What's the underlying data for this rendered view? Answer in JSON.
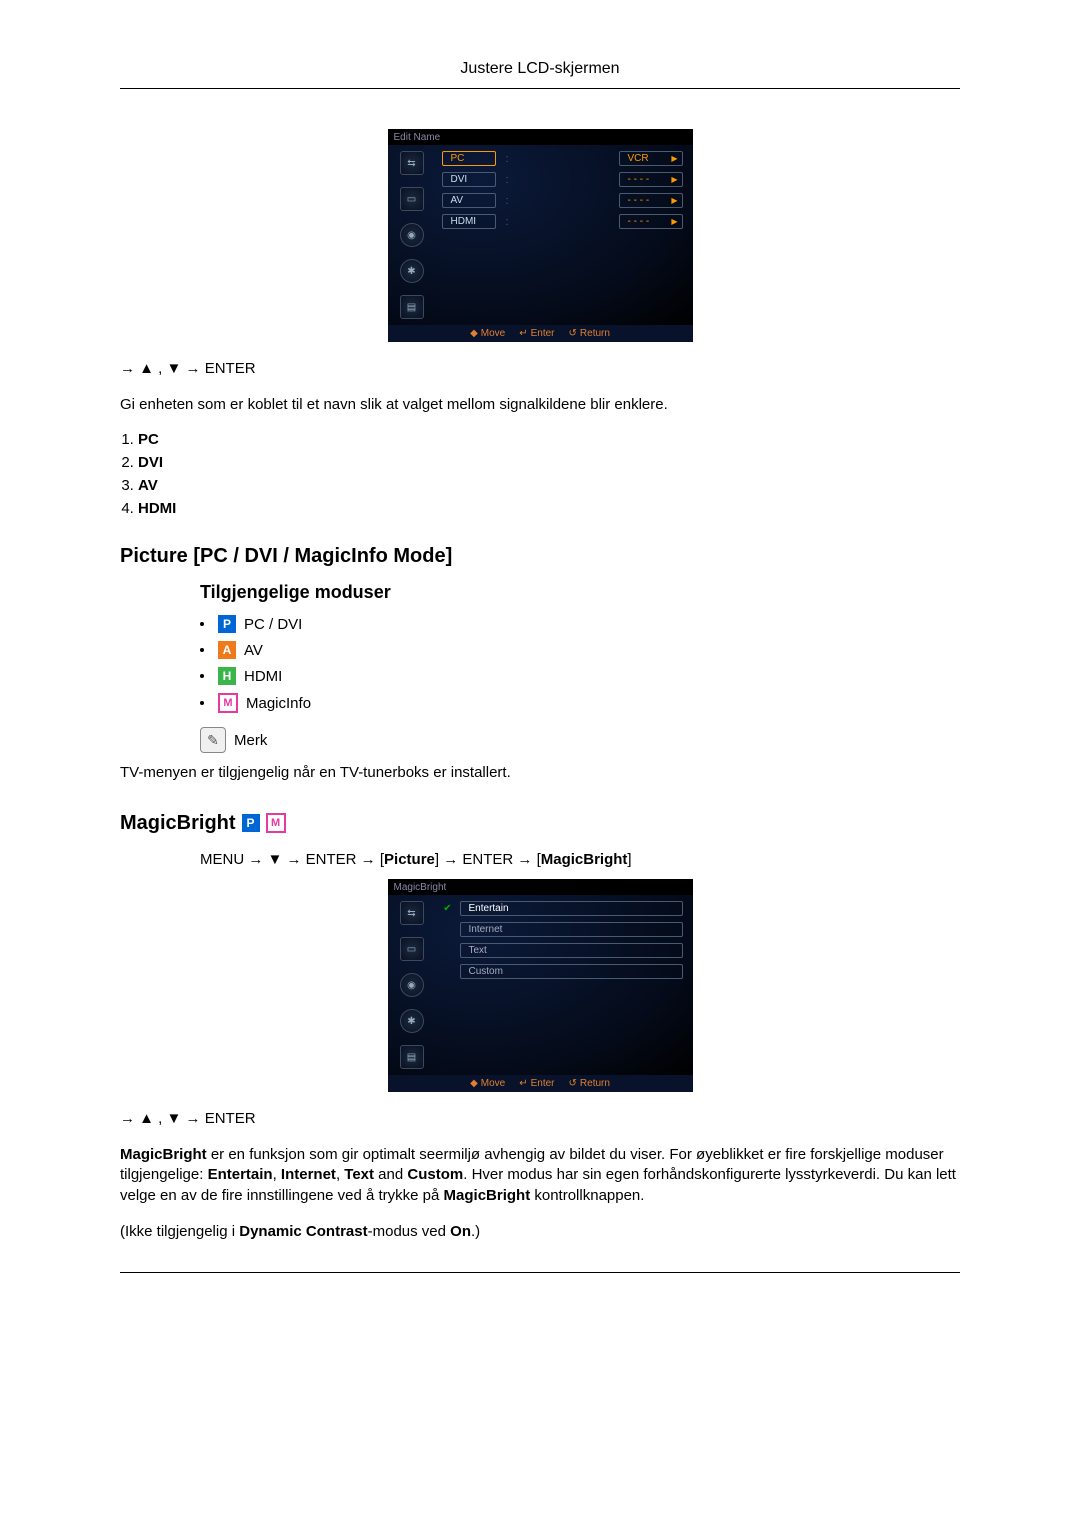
{
  "header": {
    "title": "Justere LCD-skjermen"
  },
  "osd1": {
    "title": "Edit Name",
    "rows": [
      {
        "label": "PC",
        "value": "VCR",
        "highlight": true
      },
      {
        "label": "DVI",
        "value": "- - - -"
      },
      {
        "label": "AV",
        "value": "- - - -"
      },
      {
        "label": "HDMI",
        "value": "- - - -"
      }
    ],
    "footer": {
      "move": "Move",
      "enter": "Enter",
      "return": "Return"
    }
  },
  "nav1": "→ ▲ , ▼ → ENTER",
  "intro1": "Gi enheten som er koblet til et navn slik at valget mellom signalkildene blir enklere.",
  "list1": [
    "PC",
    "DVI",
    "AV",
    "HDMI"
  ],
  "section_picture": "Picture [PC / DVI / MagicInfo Mode]",
  "sub_modes": "Tilgjengelige moduser",
  "modes": [
    {
      "badge": "P",
      "cls": "b-blue",
      "label": "PC / DVI"
    },
    {
      "badge": "A",
      "cls": "b-orange",
      "label": "AV"
    },
    {
      "badge": "H",
      "cls": "b-green",
      "label": "HDMI"
    },
    {
      "badge": "M",
      "cls": "b-pink",
      "label": "MagicInfo"
    }
  ],
  "note_label": "Merk",
  "note_text": "TV-menyen er tilgjengelig når en TV-tunerboks er installert.",
  "magicbright": {
    "title": "MagicBright",
    "path_plain": "MENU → ▼ → ENTER → [",
    "path_picture": "Picture",
    "path_mid": "] → ENTER → [",
    "path_mb": "MagicBright",
    "path_end": "]"
  },
  "osd2": {
    "title": "MagicBright",
    "rows": [
      {
        "label": "Entertain",
        "checked": true
      },
      {
        "label": "Internet"
      },
      {
        "label": "Text"
      },
      {
        "label": "Custom"
      }
    ],
    "footer": {
      "move": "Move",
      "enter": "Enter",
      "return": "Return"
    }
  },
  "nav2": "→ ▲ , ▼ → ENTER",
  "mb_para": {
    "lead_b": "MagicBright",
    "t1": " er en funksjon som gir optimalt seermiljø avhengig av bildet du viser. For øyeblikket er fire forskjellige moduser tilgjengelige: ",
    "m1": "Entertain",
    "m2": "Internet",
    "m3": "Text",
    "m4": "Custom",
    "t2": ". Hver modus har sin egen forhåndskonfigurerte lysstyrkeverdi. Du kan lett velge en av de fire innstillingene ved å trykke på  ",
    "mb2": "MagicBright",
    "t3": " kontrollknappen."
  },
  "not_avail": {
    "pre": "(Ikke tilgjengelig i ",
    "dc": "Dynamic Contrast",
    "mid": "-modus ved ",
    "on": "On",
    "post": ".)"
  }
}
